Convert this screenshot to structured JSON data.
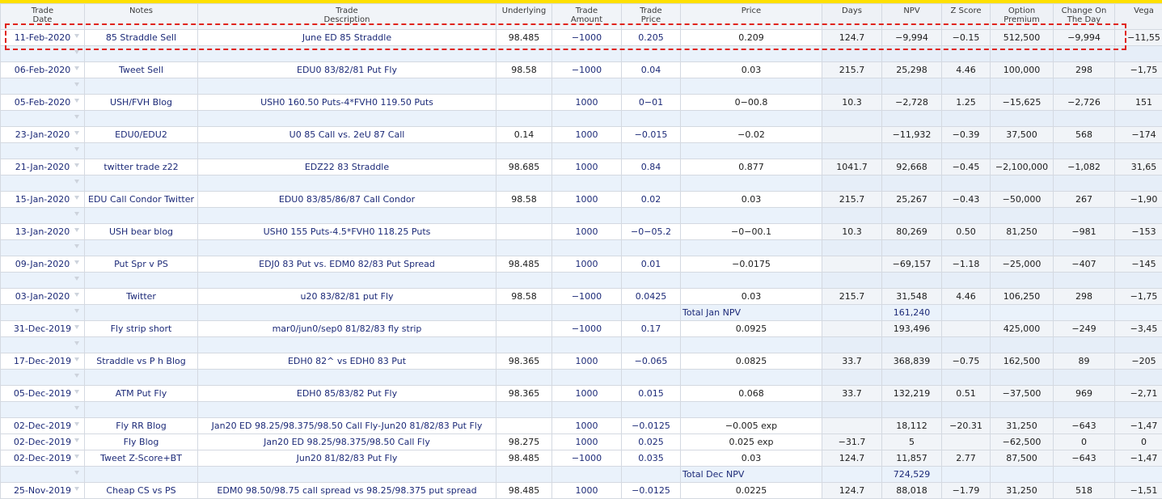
{
  "columns": [
    {
      "l1": "Trade",
      "l2": "Date"
    },
    {
      "l1": "Notes",
      "l2": ""
    },
    {
      "l1": "Trade",
      "l2": "Description"
    },
    {
      "l1": "Underlying",
      "l2": ""
    },
    {
      "l1": "Trade",
      "l2": "Amount"
    },
    {
      "l1": "Trade",
      "l2": "Price"
    },
    {
      "l1": "Price",
      "l2": ""
    },
    {
      "l1": "Days",
      "l2": ""
    },
    {
      "l1": "NPV",
      "l2": ""
    },
    {
      "l1": "Z Score",
      "l2": ""
    },
    {
      "l1": "Option",
      "l2": "Premium"
    },
    {
      "l1": "Change On",
      "l2": "The Day"
    },
    {
      "l1": "Vega",
      "l2": ""
    }
  ],
  "trades": [
    {
      "date": "11-Feb-2020",
      "notes": "85 Straddle Sell",
      "desc": "June ED 85 Straddle",
      "und": "98.485",
      "amt": "−1000",
      "tprice": "0.205",
      "price": "0.209",
      "days": "124.7",
      "npv": "−9,994",
      "z": "−0.15",
      "prem": "512,500",
      "chg": "−9,994",
      "vega": "−11,55"
    },
    {
      "date": "06-Feb-2020",
      "notes": "Tweet Sell",
      "desc": "EDU0 83/82/81 Put Fly",
      "und": "98.58",
      "amt": "−1000",
      "tprice": "0.04",
      "price": "0.03",
      "days": "215.7",
      "npv": "25,298",
      "z": "4.46",
      "prem": "100,000",
      "chg": "298",
      "vega": "−1,75"
    },
    {
      "date": "05-Feb-2020",
      "notes": "USH/FVH Blog",
      "desc": "USH0 160.50 Puts-4*FVH0 119.50 Puts",
      "und": "",
      "amt": "1000",
      "tprice": "0−01",
      "price": "0−00.8",
      "days": "10.3",
      "npv": "−2,728",
      "z": "1.25",
      "prem": "−15,625",
      "chg": "−2,726",
      "vega": "151"
    },
    {
      "date": "23-Jan-2020",
      "notes": "EDU0/EDU2",
      "desc": "U0 85 Call vs. 2eU 87 Call",
      "und": "0.14",
      "amt": "1000",
      "tprice": "−0.015",
      "price": "−0.02",
      "days": "",
      "npv": "−11,932",
      "z": "−0.39",
      "prem": "37,500",
      "chg": "568",
      "vega": "−174"
    },
    {
      "date": "21-Jan-2020",
      "notes": "twitter trade z22",
      "desc": "EDZ22 83 Straddle",
      "und": "98.685",
      "amt": "1000",
      "tprice": "0.84",
      "price": "0.877",
      "days": "1041.7",
      "npv": "92,668",
      "z": "−0.45",
      "prem": "−2,100,000",
      "chg": "−1,082",
      "vega": "31,65"
    },
    {
      "date": "15-Jan-2020",
      "notes": "EDU Call Condor Twitter",
      "desc": "EDU0 83/85/86/87 Call Condor",
      "und": "98.58",
      "amt": "1000",
      "tprice": "0.02",
      "price": "0.03",
      "days": "215.7",
      "npv": "25,267",
      "z": "−0.43",
      "prem": "−50,000",
      "chg": "267",
      "vega": "−1,90"
    },
    {
      "date": "13-Jan-2020",
      "notes": "USH bear blog",
      "desc": "USH0 155 Puts-4.5*FVH0 118.25 Puts",
      "und": "",
      "amt": "1000",
      "tprice": "−0−05.2",
      "price": "−0−00.1",
      "days": "10.3",
      "npv": "80,269",
      "z": "0.50",
      "prem": "81,250",
      "chg": "−981",
      "vega": "−153"
    },
    {
      "date": "09-Jan-2020",
      "notes": "Put Spr v PS",
      "desc": "EDJ0 83 Put vs. EDM0 82/83 Put Spread",
      "und": "98.485",
      "amt": "1000",
      "tprice": "0.01",
      "price": "−0.0175",
      "days": "",
      "npv": "−69,157",
      "z": "−1.18",
      "prem": "−25,000",
      "chg": "−407",
      "vega": "−145"
    },
    {
      "date": "03-Jan-2020",
      "notes": "Twitter",
      "desc": "u20 83/82/81 put Fly",
      "und": "98.58",
      "amt": "−1000",
      "tprice": "0.0425",
      "price": "0.03",
      "days": "215.7",
      "npv": "31,548",
      "z": "4.46",
      "prem": "106,250",
      "chg": "298",
      "vega": "−1,75"
    },
    {
      "date": "31-Dec-2019",
      "notes": "Fly strip short",
      "desc": "mar0/jun0/sep0 81/82/83 fly strip",
      "und": "",
      "amt": "−1000",
      "tprice": "0.17",
      "price": "0.0925",
      "days": "",
      "npv": "193,496",
      "z": "",
      "prem": "425,000",
      "chg": "−249",
      "vega": "−3,45"
    },
    {
      "date": "17-Dec-2019",
      "notes": "Straddle vs P h Blog",
      "desc": "EDH0 82^ vs EDH0 83 Put",
      "und": "98.365",
      "amt": "1000",
      "tprice": "−0.065",
      "price": "0.0825",
      "days": "33.7",
      "npv": "368,839",
      "z": "−0.75",
      "prem": "162,500",
      "chg": "89",
      "vega": "−205"
    },
    {
      "date": "05-Dec-2019",
      "notes": "ATM Put Fly",
      "desc": "EDH0 85/83/82 Put Fly",
      "und": "98.365",
      "amt": "1000",
      "tprice": "0.015",
      "price": "0.068",
      "days": "33.7",
      "npv": "132,219",
      "z": "0.51",
      "prem": "−37,500",
      "chg": "969",
      "vega": "−2,71"
    },
    {
      "date": "02-Dec-2019",
      "notes": "Fly RR Blog",
      "desc": "Jan20 ED 98.25/98.375/98.50 Call Fly-Jun20 81/82/83 Put Fly",
      "und": "",
      "amt": "1000",
      "tprice": "−0.0125",
      "price": "−0.005 exp",
      "days": "",
      "npv": "18,112",
      "z": "−20.31",
      "prem": "31,250",
      "chg": "−643",
      "vega": "−1,47"
    },
    {
      "date": "02-Dec-2019",
      "notes": "Fly Blog",
      "desc": "Jan20 ED 98.25/98.375/98.50 Call Fly",
      "und": "98.275",
      "amt": "1000",
      "tprice": "0.025",
      "price": "0.025 exp",
      "days": "−31.7",
      "npv": "5",
      "z": "",
      "prem": "−62,500",
      "chg": "0",
      "vega": "0"
    },
    {
      "date": "02-Dec-2019",
      "notes": "Tweet Z-Score+BT",
      "desc": "Jun20 81/82/83 Put Fly",
      "und": "98.485",
      "amt": "−1000",
      "tprice": "0.035",
      "price": "0.03",
      "days": "124.7",
      "npv": "11,857",
      "z": "2.77",
      "prem": "87,500",
      "chg": "−643",
      "vega": "−1,47"
    },
    {
      "date": "25-Nov-2019",
      "notes": "Cheap CS vs PS",
      "desc": "EDM0 98.50/98.75 call spread vs 98.25/98.375 put spread",
      "und": "98.485",
      "amt": "1000",
      "tprice": "−0.0125",
      "price": "0.0225",
      "days": "124.7",
      "npv": "88,018",
      "z": "−1.79",
      "prem": "31,250",
      "chg": "518",
      "vega": "−1,51"
    }
  ],
  "totals": {
    "jan": {
      "label": "Total Jan NPV",
      "value": "161,240"
    },
    "dec": {
      "label": "Total Dec NPV",
      "value": "724,529"
    }
  }
}
